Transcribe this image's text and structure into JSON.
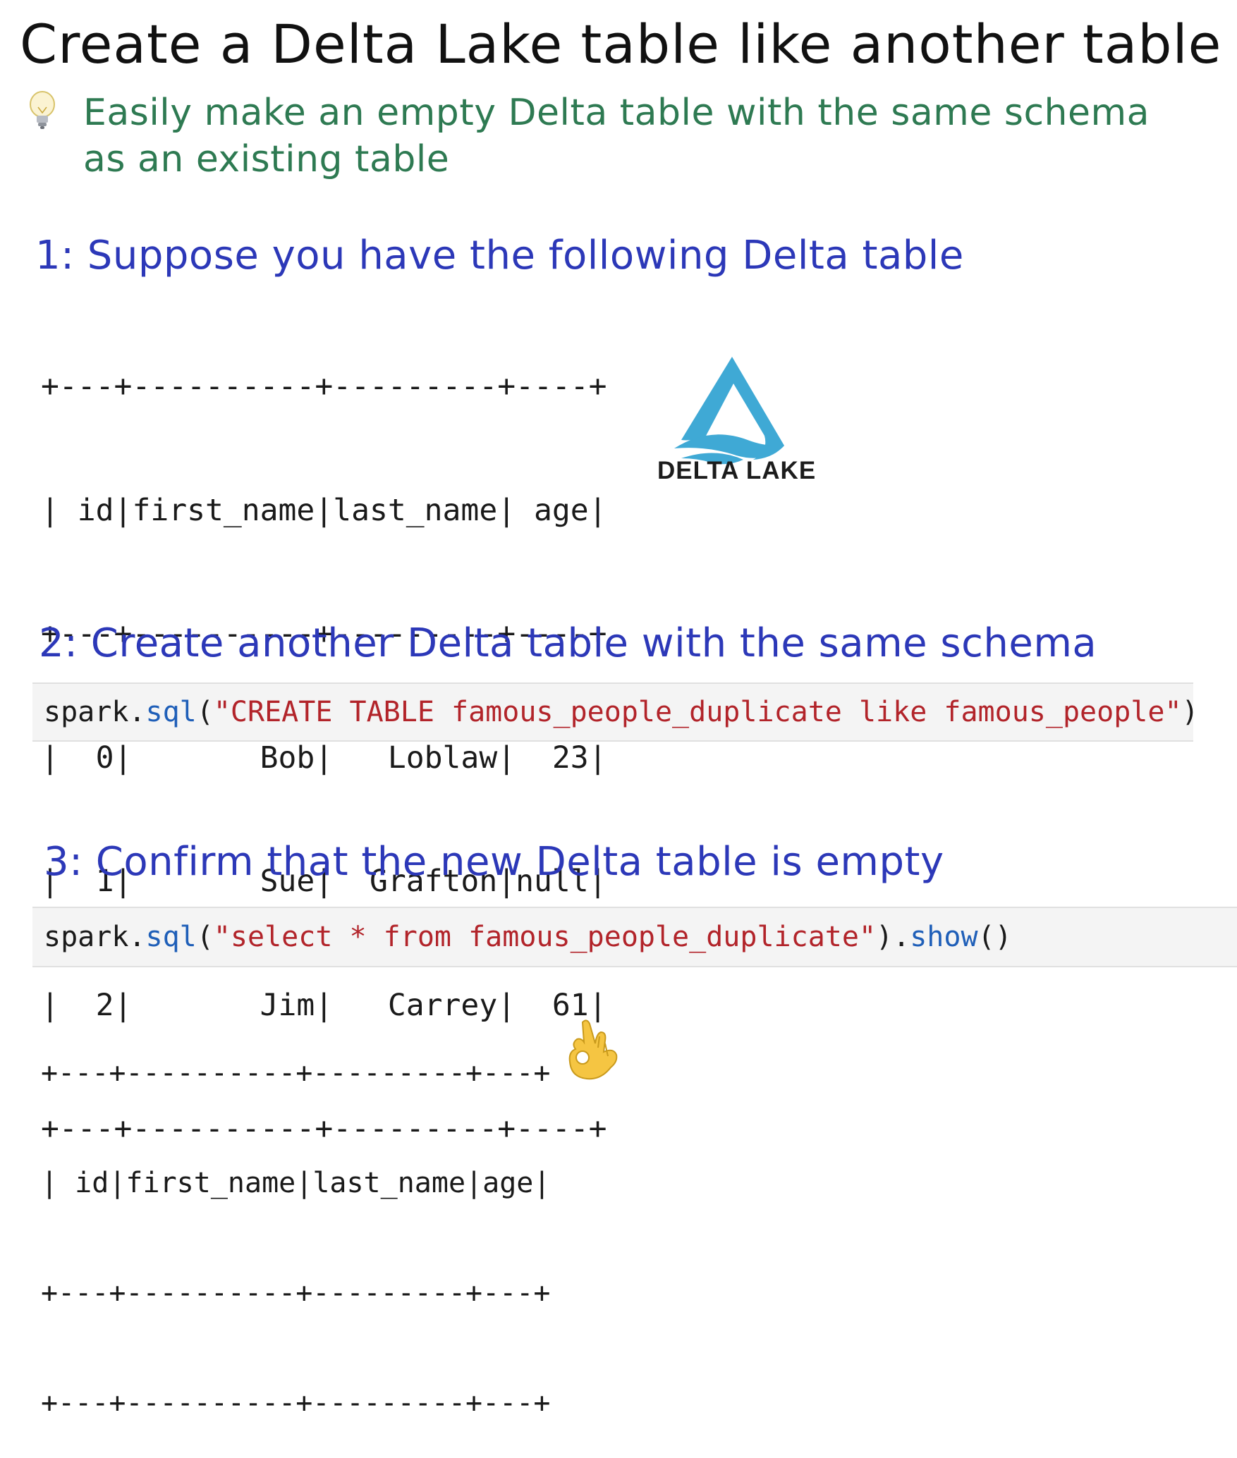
{
  "title": "Create a Delta Lake table like another table",
  "tip": {
    "icon": "lightbulb-icon",
    "line1": "Easily make an empty Delta table with the same schema",
    "line2": "as an existing table"
  },
  "steps": [
    {
      "label": "1: Suppose you have the following Delta table"
    },
    {
      "label": "2: Create another Delta table with the same schema"
    },
    {
      "label": "3: Confirm that the new Delta table is empty"
    }
  ],
  "source_table": {
    "lines": [
      "+---+----------+---------+----+",
      "| id|first_name|last_name| age|",
      "+---+----------+---------+----+",
      "|  0|       Bob|   Loblaw|  23|",
      "|  1|       Sue|  Grafton|null|",
      "|  2|       Jim|   Carrey|  61|",
      "+---+----------+---------+----+"
    ],
    "columns": [
      "id",
      "first_name",
      "last_name",
      "age"
    ],
    "rows": [
      [
        "0",
        "Bob",
        "Loblaw",
        "23"
      ],
      [
        "1",
        "Sue",
        "Grafton",
        "null"
      ],
      [
        "2",
        "Jim",
        "Carrey",
        "61"
      ]
    ]
  },
  "logo": {
    "text": "DELTA LAKE",
    "icon": "delta-lake-logo-icon",
    "color": "#3fa9d5"
  },
  "code1": {
    "obj": "spark.",
    "fn": "sql",
    "open": "(",
    "str": "\"CREATE TABLE famous_people_duplicate like famous_people\"",
    "close": ")"
  },
  "code2": {
    "obj": "spark.",
    "fn": "sql",
    "open": "(",
    "str": "\"select * from famous_people_duplicate\"",
    "mid": ").",
    "fn2": "show",
    "close": "()"
  },
  "result_table": {
    "lines": [
      "+---+----------+---------+---+",
      "| id|first_name|last_name|age|",
      "+---+----------+---------+---+",
      "+---+----------+---------+---+"
    ]
  },
  "emoji": {
    "icon": "ok-hand-icon"
  },
  "colors": {
    "title": "#111111",
    "tip": "#2e7a52",
    "step": "#2c38b8",
    "code_fn": "#1f5fb8",
    "code_string": "#b2242a",
    "code_bg": "#f4f4f4"
  }
}
